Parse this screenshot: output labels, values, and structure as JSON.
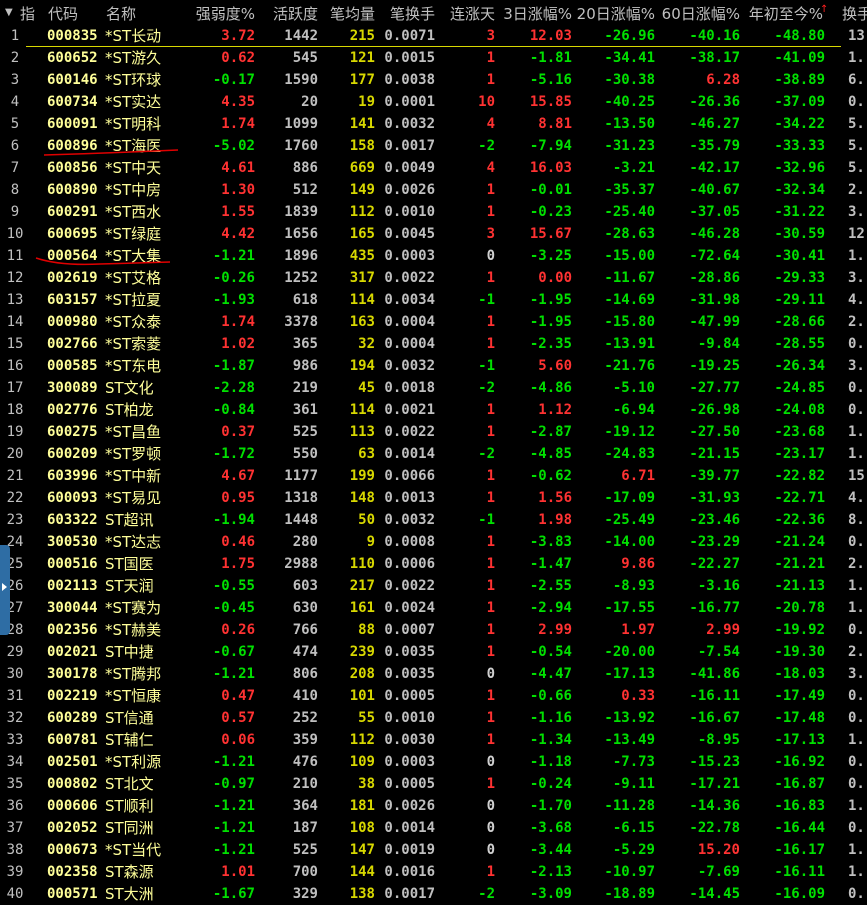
{
  "header": {
    "sort_indicator_icon": "triangle-down-icon",
    "columns": [
      "指",
      "代码",
      "名称",
      "强弱度%",
      "活跃度",
      "笔均量",
      "笔换手",
      "连涨天",
      "3日涨幅%",
      "20日涨幅%",
      "60日涨幅%",
      "年初至今%",
      "换手"
    ],
    "sorted_column": "年初至今%",
    "sort_direction_icon": "arrow-up-icon"
  },
  "colors": {
    "up": "#ff3232",
    "down": "#00e000",
    "code": "#ffff99",
    "volume": "#d8d800",
    "neutral": "#c0c0c0",
    "selection_line": "#d8d800",
    "annotation": "#e00000"
  },
  "annotations": {
    "underlined_rows": [
      6,
      11
    ]
  },
  "rows": [
    [
      "1",
      "000835",
      "*ST长动",
      "3.72",
      "1442",
      "215",
      "0.0071",
      "3",
      "12.03",
      "-26.96",
      "-40.16",
      "-48.80",
      "13."
    ],
    [
      "2",
      "600652",
      "*ST游久",
      "0.62",
      "545",
      "121",
      "0.0015",
      "1",
      "-1.81",
      "-34.41",
      "-38.17",
      "-41.09",
      "1."
    ],
    [
      "3",
      "600146",
      "*ST环球",
      "-0.17",
      "1590",
      "177",
      "0.0038",
      "1",
      "-5.16",
      "-30.38",
      "6.28",
      "-38.89",
      "6."
    ],
    [
      "4",
      "600734",
      "*ST实达",
      "4.35",
      "20",
      "19",
      "0.0001",
      "10",
      "15.85",
      "-40.25",
      "-26.36",
      "-37.09",
      "0."
    ],
    [
      "5",
      "600091",
      "*ST明科",
      "1.74",
      "1099",
      "141",
      "0.0032",
      "4",
      "8.81",
      "-13.50",
      "-46.27",
      "-34.22",
      "5."
    ],
    [
      "6",
      "600896",
      "*ST海医",
      "-5.02",
      "1760",
      "158",
      "0.0017",
      "-2",
      "-7.94",
      "-31.23",
      "-35.79",
      "-33.33",
      "5."
    ],
    [
      "7",
      "600856",
      "*ST中天",
      "4.61",
      "886",
      "669",
      "0.0049",
      "4",
      "16.03",
      "-3.21",
      "-42.17",
      "-32.96",
      "5."
    ],
    [
      "8",
      "600890",
      "*ST中房",
      "1.30",
      "512",
      "149",
      "0.0026",
      "1",
      "-0.01",
      "-35.37",
      "-40.67",
      "-32.34",
      "2."
    ],
    [
      "9",
      "600291",
      "*ST西水",
      "1.55",
      "1839",
      "112",
      "0.0010",
      "1",
      "-0.23",
      "-25.40",
      "-37.05",
      "-31.22",
      "3."
    ],
    [
      "10",
      "600695",
      "*ST绿庭",
      "4.42",
      "1656",
      "165",
      "0.0045",
      "3",
      "15.67",
      "-28.63",
      "-46.28",
      "-30.59",
      "12."
    ],
    [
      "11",
      "000564",
      "*ST大集",
      "-1.21",
      "1896",
      "435",
      "0.0003",
      "0",
      "-3.25",
      "-15.00",
      "-72.64",
      "-30.41",
      "1."
    ],
    [
      "12",
      "002619",
      "*ST艾格",
      "-0.26",
      "1252",
      "317",
      "0.0022",
      "1",
      "0.00",
      "-11.67",
      "-28.86",
      "-29.33",
      "3."
    ],
    [
      "13",
      "603157",
      "*ST拉夏",
      "-1.93",
      "618",
      "114",
      "0.0034",
      "-1",
      "-1.95",
      "-14.69",
      "-31.98",
      "-29.11",
      "4."
    ],
    [
      "14",
      "000980",
      "*ST众泰",
      "1.74",
      "3378",
      "163",
      "0.0004",
      "1",
      "-1.95",
      "-15.80",
      "-47.99",
      "-28.66",
      "2."
    ],
    [
      "15",
      "002766",
      "*ST索菱",
      "1.02",
      "365",
      "32",
      "0.0004",
      "1",
      "-2.35",
      "-13.91",
      "-9.84",
      "-28.55",
      "0."
    ],
    [
      "16",
      "000585",
      "*ST东电",
      "-1.87",
      "986",
      "194",
      "0.0032",
      "-1",
      "5.60",
      "-21.76",
      "-19.25",
      "-26.34",
      "3."
    ],
    [
      "17",
      "300089",
      "ST文化",
      "-2.28",
      "219",
      "45",
      "0.0018",
      "-2",
      "-4.86",
      "-5.10",
      "-27.77",
      "-24.85",
      "0."
    ],
    [
      "18",
      "002776",
      "ST柏龙",
      "-0.84",
      "361",
      "114",
      "0.0021",
      "1",
      "1.12",
      "-6.94",
      "-26.98",
      "-24.08",
      "0."
    ],
    [
      "19",
      "600275",
      "*ST昌鱼",
      "0.37",
      "525",
      "113",
      "0.0022",
      "1",
      "-2.87",
      "-19.12",
      "-27.50",
      "-23.68",
      "1."
    ],
    [
      "20",
      "600209",
      "*ST罗顿",
      "-1.72",
      "550",
      "63",
      "0.0014",
      "-2",
      "-4.85",
      "-24.83",
      "-21.15",
      "-23.17",
      "1."
    ],
    [
      "21",
      "603996",
      "*ST中新",
      "4.67",
      "1177",
      "199",
      "0.0066",
      "1",
      "-0.62",
      "6.71",
      "-39.77",
      "-22.82",
      "15."
    ],
    [
      "22",
      "600093",
      "*ST易见",
      "0.95",
      "1318",
      "148",
      "0.0013",
      "1",
      "1.56",
      "-17.09",
      "-31.93",
      "-22.71",
      "4."
    ],
    [
      "23",
      "603322",
      "ST超讯",
      "-1.94",
      "1448",
      "50",
      "0.0032",
      "-1",
      "1.98",
      "-25.49",
      "-23.46",
      "-22.36",
      "8."
    ],
    [
      "24",
      "300530",
      "*ST达志",
      "0.46",
      "280",
      "9",
      "0.0008",
      "1",
      "-3.83",
      "-14.00",
      "-23.29",
      "-21.24",
      "0."
    ],
    [
      "25",
      "000516",
      "ST国医",
      "1.75",
      "2988",
      "110",
      "0.0006",
      "1",
      "-1.47",
      "9.86",
      "-22.27",
      "-21.21",
      "2."
    ],
    [
      "26",
      "002113",
      "ST天润",
      "-0.55",
      "603",
      "217",
      "0.0022",
      "1",
      "-2.55",
      "-8.93",
      "-3.16",
      "-21.13",
      "1."
    ],
    [
      "27",
      "300044",
      "*ST赛为",
      "-0.45",
      "630",
      "161",
      "0.0024",
      "1",
      "-2.94",
      "-17.55",
      "-16.77",
      "-20.78",
      "1."
    ],
    [
      "28",
      "002356",
      "*ST赫美",
      "0.26",
      "766",
      "88",
      "0.0007",
      "1",
      "2.99",
      "1.97",
      "2.99",
      "-19.92",
      "0."
    ],
    [
      "29",
      "002021",
      "ST中捷",
      "-0.67",
      "474",
      "239",
      "0.0035",
      "1",
      "-0.54",
      "-20.00",
      "-7.54",
      "-19.30",
      "2."
    ],
    [
      "30",
      "300178",
      "*ST腾邦",
      "-1.21",
      "806",
      "208",
      "0.0035",
      "0",
      "-4.47",
      "-17.13",
      "-41.86",
      "-18.03",
      "3."
    ],
    [
      "31",
      "002219",
      "*ST恒康",
      "0.47",
      "410",
      "101",
      "0.0005",
      "1",
      "-0.66",
      "0.33",
      "-16.11",
      "-17.49",
      "0."
    ],
    [
      "32",
      "600289",
      "ST信通",
      "0.57",
      "252",
      "55",
      "0.0010",
      "1",
      "-1.16",
      "-13.92",
      "-16.67",
      "-17.48",
      "0."
    ],
    [
      "33",
      "600781",
      "ST辅仁",
      "0.06",
      "359",
      "112",
      "0.0030",
      "1",
      "-1.34",
      "-13.49",
      "-8.95",
      "-17.13",
      "1."
    ],
    [
      "34",
      "002501",
      "*ST利源",
      "-1.21",
      "476",
      "109",
      "0.0003",
      "0",
      "-1.18",
      "-7.73",
      "-15.23",
      "-16.92",
      "0."
    ],
    [
      "35",
      "000802",
      "ST北文",
      "-0.97",
      "210",
      "38",
      "0.0005",
      "1",
      "-0.24",
      "-9.11",
      "-17.21",
      "-16.87",
      "0."
    ],
    [
      "36",
      "000606",
      "ST顺利",
      "-1.21",
      "364",
      "181",
      "0.0026",
      "0",
      "-1.70",
      "-11.28",
      "-14.36",
      "-16.83",
      "1."
    ],
    [
      "37",
      "002052",
      "ST同洲",
      "-1.21",
      "187",
      "108",
      "0.0014",
      "0",
      "-3.68",
      "-6.15",
      "-22.78",
      "-16.44",
      "0."
    ],
    [
      "38",
      "000673",
      "*ST当代",
      "-1.21",
      "525",
      "147",
      "0.0019",
      "0",
      "-3.44",
      "-5.29",
      "15.20",
      "-16.17",
      "1."
    ],
    [
      "39",
      "002358",
      "ST森源",
      "1.01",
      "700",
      "144",
      "0.0016",
      "1",
      "-2.13",
      "-10.97",
      "-7.69",
      "-16.11",
      "1."
    ],
    [
      "40",
      "000571",
      "ST大洲",
      "-1.67",
      "329",
      "138",
      "0.0017",
      "-2",
      "-3.09",
      "-18.89",
      "-14.45",
      "-16.09",
      "0."
    ]
  ]
}
